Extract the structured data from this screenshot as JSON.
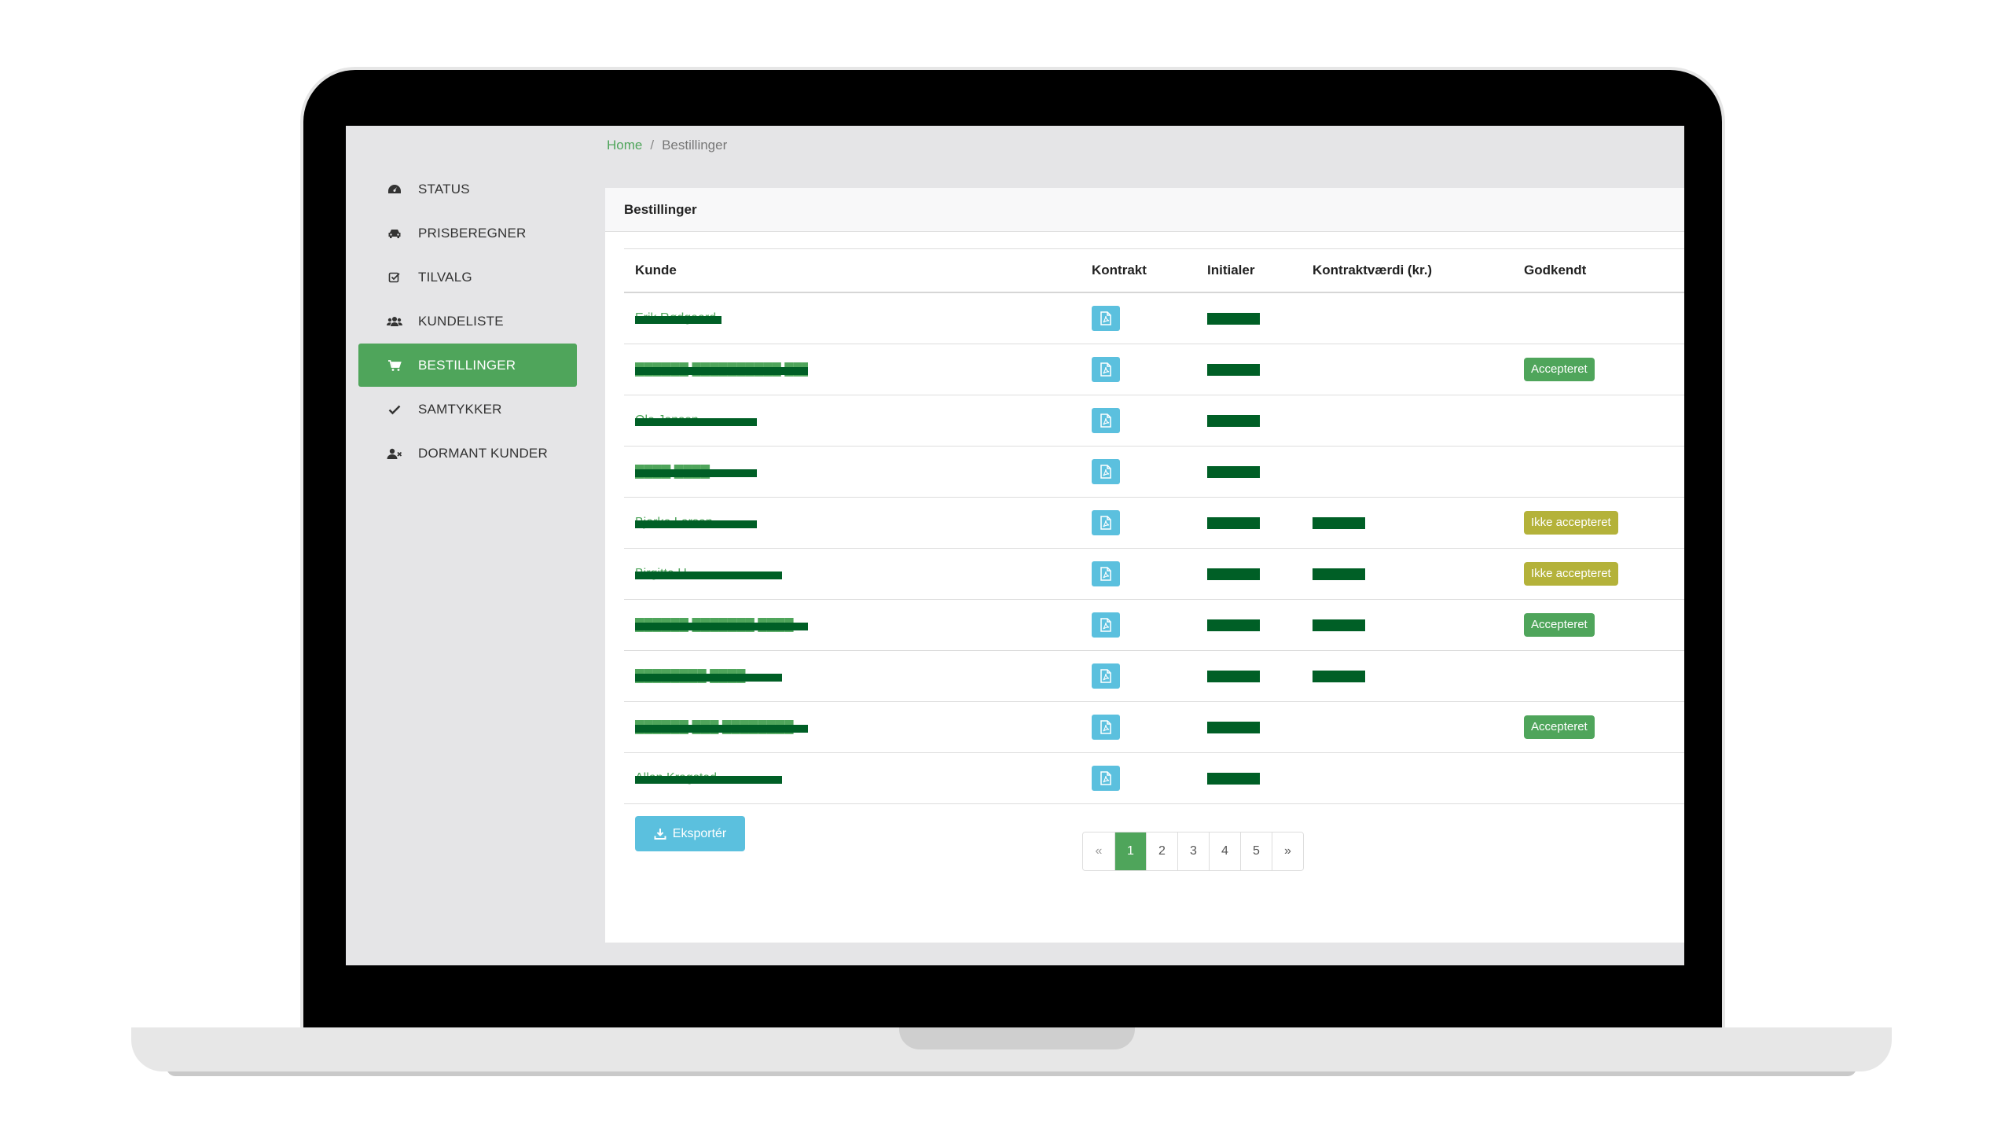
{
  "breadcrumb": {
    "home": "Home",
    "separator": "/",
    "current": "Bestillinger"
  },
  "sidebar": {
    "items": [
      {
        "label": "STATUS",
        "icon": "dashboard-icon"
      },
      {
        "label": "PRISBEREGNER",
        "icon": "car-icon"
      },
      {
        "label": "TILVALG",
        "icon": "checkbox-icon"
      },
      {
        "label": "KUNDELISTE",
        "icon": "users-icon"
      },
      {
        "label": "BESTILLINGER",
        "icon": "cart-icon",
        "active": true
      },
      {
        "label": "SAMTYKKER",
        "icon": "check-icon"
      },
      {
        "label": "DORMANT KUNDER",
        "icon": "user-times-icon"
      }
    ]
  },
  "card": {
    "title": "Bestillinger"
  },
  "table": {
    "headers": {
      "kunde": "Kunde",
      "kontrakt": "Kontrakt",
      "initialer": "Initialer",
      "vaerdi": "Kontraktværdi (kr.)",
      "godkendt": "Godkendt"
    },
    "rows": [
      {
        "kunde": "Erik Rødgaard",
        "initialer_redacted": true,
        "vaerdi_redacted": false,
        "godkendt": ""
      },
      {
        "kunde": "██████ ██████████ ███",
        "initialer_redacted": true,
        "vaerdi_redacted": false,
        "godkendt": "Accepteret"
      },
      {
        "kunde": "Ole Jensen",
        "initialer_redacted": true,
        "vaerdi_redacted": false,
        "godkendt": ""
      },
      {
        "kunde": "████ ████",
        "initialer_redacted": true,
        "vaerdi_redacted": false,
        "godkendt": ""
      },
      {
        "kunde": "Bjarke Larsen",
        "initialer_redacted": true,
        "vaerdi_redacted": true,
        "godkendt": "Ikke accepteret"
      },
      {
        "kunde": "Birgitte H",
        "initialer_redacted": true,
        "vaerdi_redacted": true,
        "godkendt": "Ikke accepteret"
      },
      {
        "kunde": "██████ ███████ ████",
        "initialer_redacted": true,
        "vaerdi_redacted": true,
        "godkendt": "Accepteret"
      },
      {
        "kunde": "████████ ████",
        "initialer_redacted": true,
        "vaerdi_redacted": true,
        "godkendt": ""
      },
      {
        "kunde": "██████ ███ ████████",
        "initialer_redacted": true,
        "vaerdi_redacted": false,
        "godkendt": "Accepteret"
      },
      {
        "kunde": "Allan Kragsted",
        "initialer_redacted": true,
        "vaerdi_redacted": false,
        "godkendt": ""
      }
    ]
  },
  "export": {
    "label": "Eksportér"
  },
  "pagination": {
    "prev": "«",
    "pages": [
      "1",
      "2",
      "3",
      "4",
      "5"
    ],
    "active": "1",
    "next": "»"
  },
  "colors": {
    "accent": "#4fa55b",
    "info": "#5bc0de",
    "warning": "#b4b23a",
    "redaction": "#005f26"
  }
}
